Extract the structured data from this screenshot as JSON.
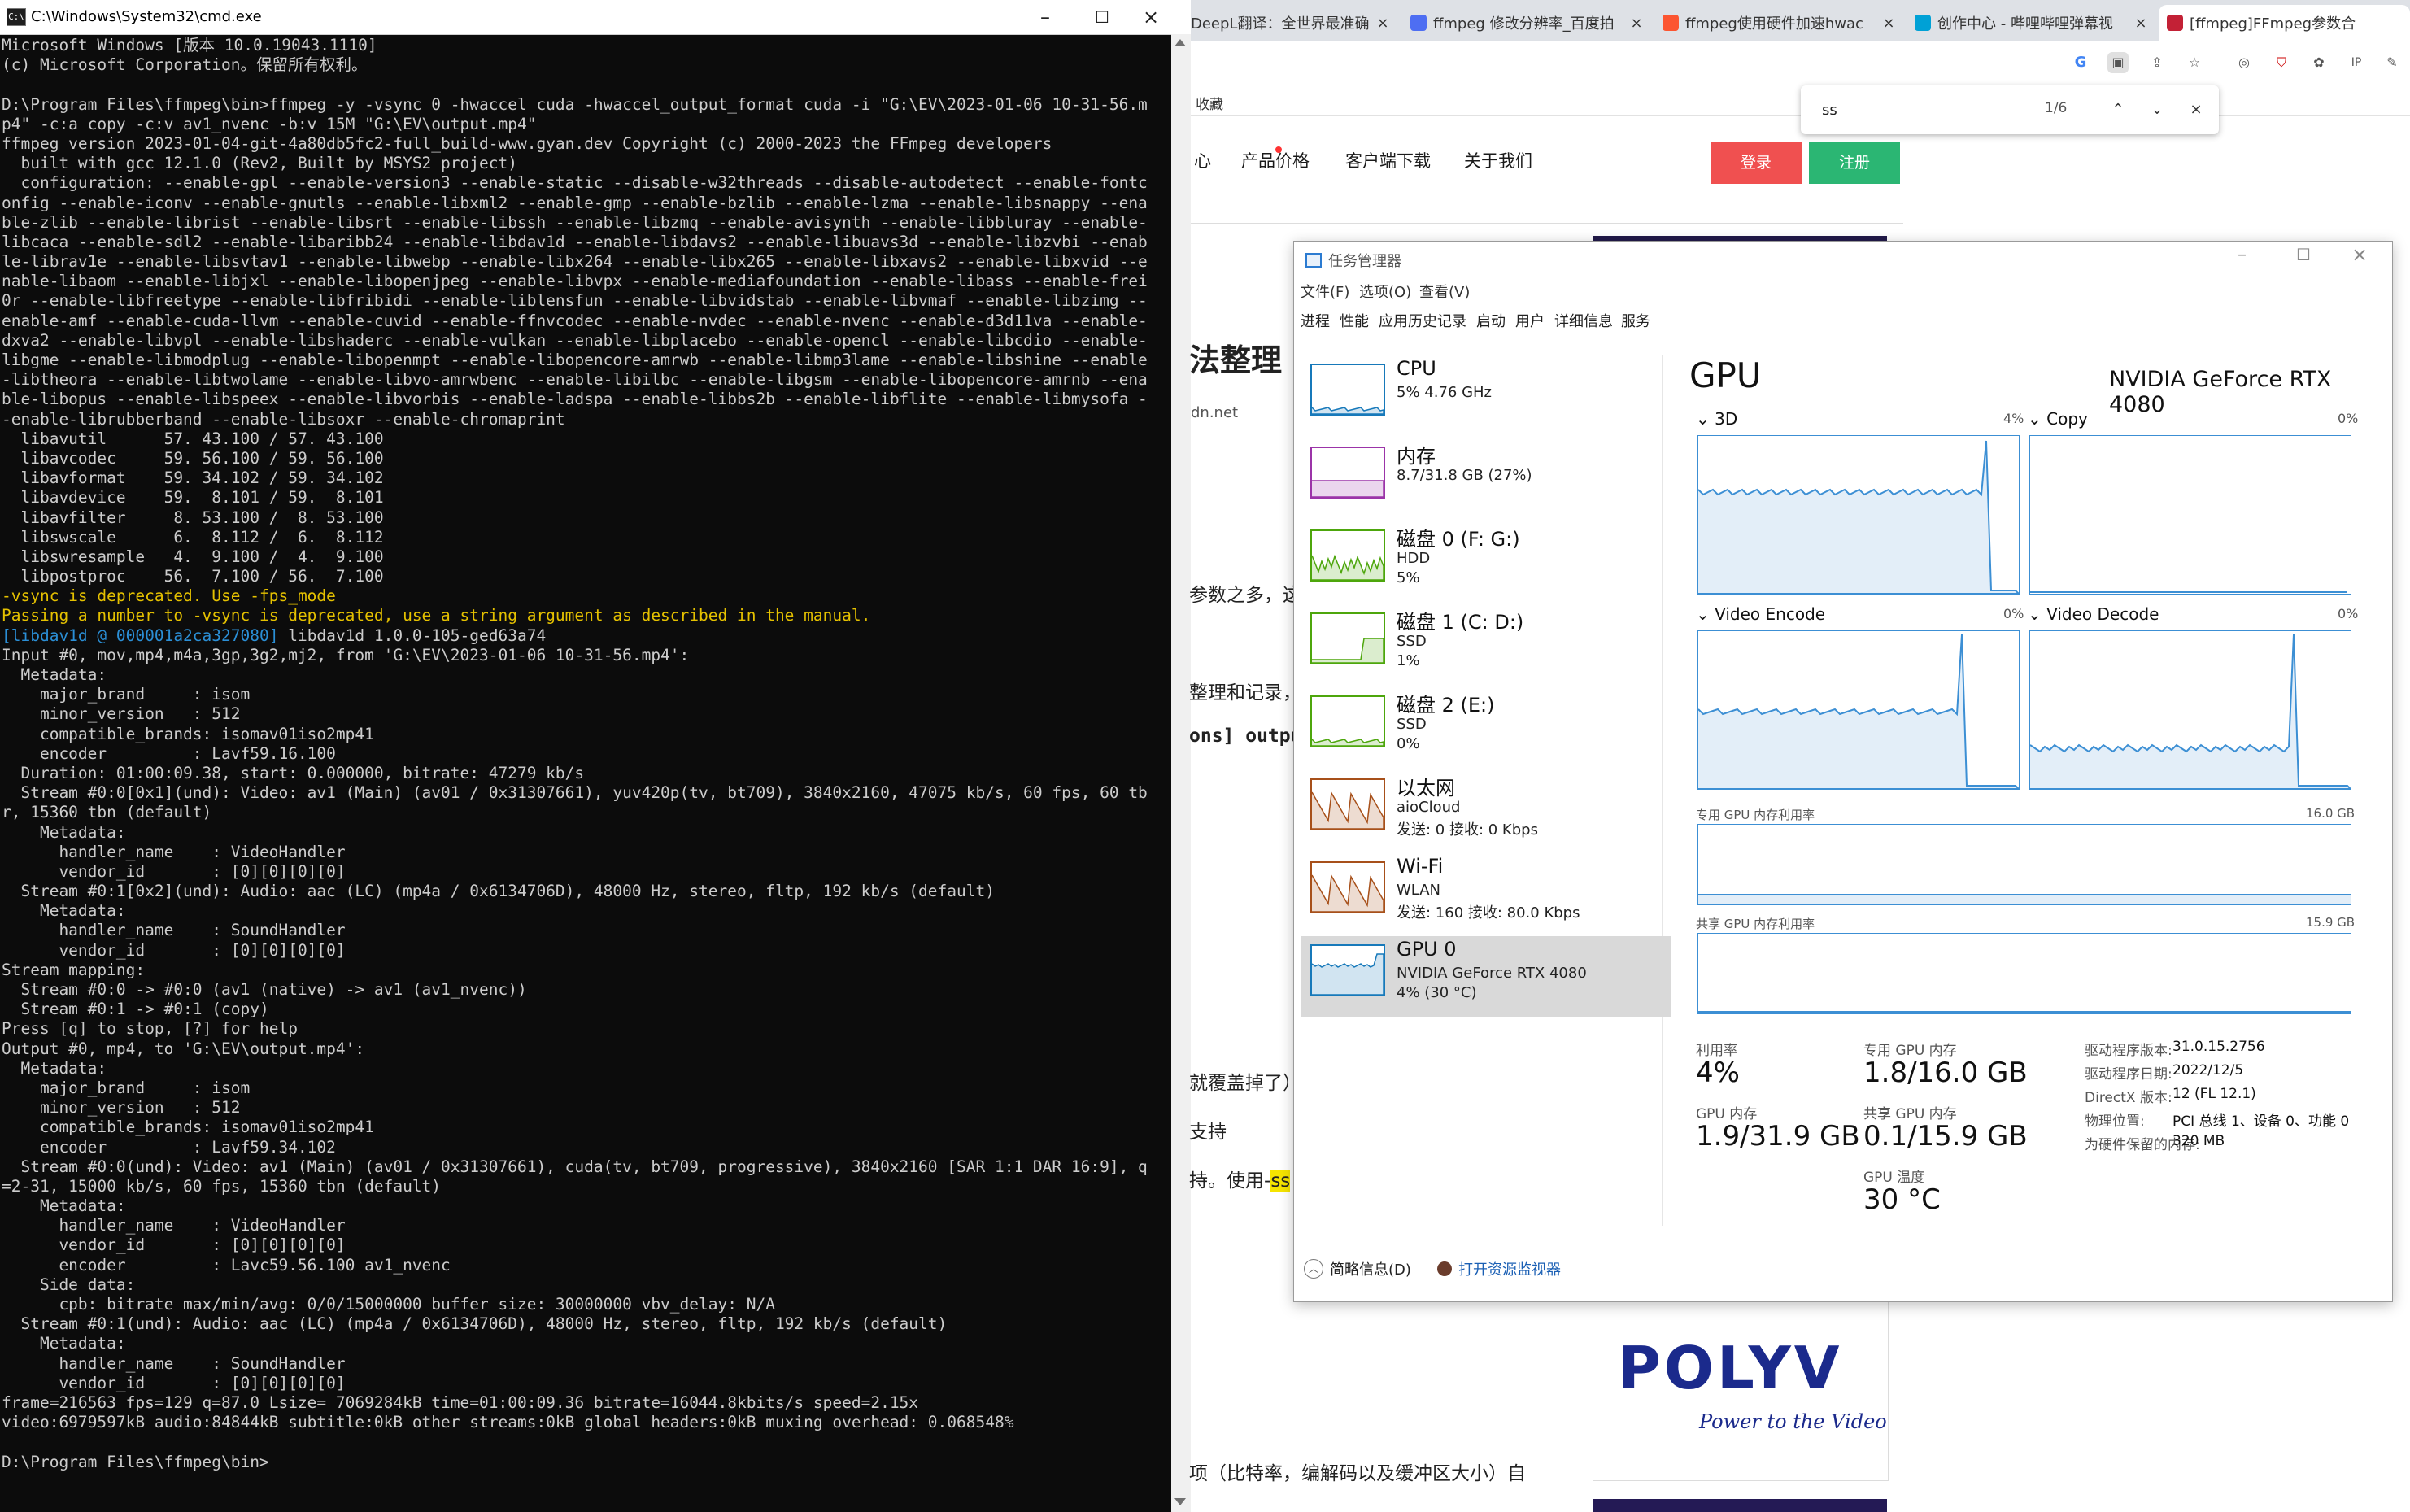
{
  "cmd": {
    "title": "C:\\Windows\\System32\\cmd.exe",
    "icon_text": "C:\\",
    "lines": [
      {
        "t": "Microsoft Windows [版本 10.0.19043.1110]"
      },
      {
        "t": "(c) Microsoft Corporation。保留所有权利。"
      },
      {
        "t": ""
      },
      {
        "t": "D:\\Program Files\\ffmpeg\\bin>ffmpeg -y -vsync 0 -hwaccel cuda -hwaccel_output_format cuda -i \"G:\\EV\\2023-01-06 10-31-56.m"
      },
      {
        "t": "p4\" -c:a copy -c:v av1_nvenc -b:v 15M \"G:\\EV\\output.mp4\""
      },
      {
        "t": "ffmpeg version 2023-01-04-git-4a80db5fc2-full_build-www.gyan.dev Copyright (c) 2000-2023 the FFmpeg developers"
      },
      {
        "t": "  built with gcc 12.1.0 (Rev2, Built by MSYS2 project)"
      },
      {
        "t": "  configuration: --enable-gpl --enable-version3 --enable-static --disable-w32threads --disable-autodetect --enable-fontc"
      },
      {
        "t": "onfig --enable-iconv --enable-gnutls --enable-libxml2 --enable-gmp --enable-bzlib --enable-lzma --enable-libsnappy --ena"
      },
      {
        "t": "ble-zlib --enable-librist --enable-libsrt --enable-libssh --enable-libzmq --enable-avisynth --enable-libbluray --enable-"
      },
      {
        "t": "libcaca --enable-sdl2 --enable-libaribb24 --enable-libdav1d --enable-libdavs2 --enable-libuavs3d --enable-libzvbi --enab"
      },
      {
        "t": "le-librav1e --enable-libsvtav1 --enable-libwebp --enable-libx264 --enable-libx265 --enable-libxavs2 --enable-libxvid --e"
      },
      {
        "t": "nable-libaom --enable-libjxl --enable-libopenjpeg --enable-libvpx --enable-mediafoundation --enable-libass --enable-frei"
      },
      {
        "t": "0r --enable-libfreetype --enable-libfribidi --enable-liblensfun --enable-libvidstab --enable-libvmaf --enable-libzimg --"
      },
      {
        "t": "enable-amf --enable-cuda-llvm --enable-cuvid --enable-ffnvcodec --enable-nvdec --enable-nvenc --enable-d3d11va --enable-"
      },
      {
        "t": "dxva2 --enable-libvpl --enable-libshaderc --enable-vulkan --enable-libplacebo --enable-opencl --enable-libcdio --enable-"
      },
      {
        "t": "libgme --enable-libmodplug --enable-libopenmpt --enable-libopencore-amrwb --enable-libmp3lame --enable-libshine --enable"
      },
      {
        "t": "-libtheora --enable-libtwolame --enable-libvo-amrwbenc --enable-libilbc --enable-libgsm --enable-libopencore-amrnb --ena"
      },
      {
        "t": "ble-libopus --enable-libspeex --enable-libvorbis --enable-ladspa --enable-libbs2b --enable-libflite --enable-libmysofa -"
      },
      {
        "t": "-enable-librubberband --enable-libsoxr --enable-chromaprint"
      },
      {
        "t": "  libavutil      57. 43.100 / 57. 43.100"
      },
      {
        "t": "  libavcodec     59. 56.100 / 59. 56.100"
      },
      {
        "t": "  libavformat    59. 34.102 / 59. 34.102"
      },
      {
        "t": "  libavdevice    59.  8.101 / 59.  8.101"
      },
      {
        "t": "  libavfilter     8. 53.100 /  8. 53.100"
      },
      {
        "t": "  libswscale      6.  8.112 /  6.  8.112"
      },
      {
        "t": "  libswresample   4.  9.100 /  4.  9.100"
      },
      {
        "t": "  libpostproc    56.  7.100 / 56.  7.100"
      },
      {
        "t": "-vsync is deprecated. Use -fps_mode",
        "c": "y"
      },
      {
        "t": "Passing a number to -vsync is deprecated, use a string argument as described in the manual.",
        "c": "y"
      },
      {
        "pre": "[libdav1d @ 000001a2ca327080]",
        "t": " libdav1d 1.0.0-105-ged63a74"
      },
      {
        "t": "Input #0, mov,mp4,m4a,3gp,3g2,mj2, from 'G:\\EV\\2023-01-06 10-31-56.mp4':"
      },
      {
        "t": "  Metadata:"
      },
      {
        "t": "    major_brand     : isom"
      },
      {
        "t": "    minor_version   : 512"
      },
      {
        "t": "    compatible_brands: isomav01iso2mp41"
      },
      {
        "t": "    encoder         : Lavf59.16.100"
      },
      {
        "t": "  Duration: 01:00:09.38, start: 0.000000, bitrate: 47279 kb/s"
      },
      {
        "t": "  Stream #0:0[0x1](und): Video: av1 (Main) (av01 / 0x31307661), yuv420p(tv, bt709), 3840x2160, 47075 kb/s, 60 fps, 60 tb"
      },
      {
        "t": "r, 15360 tbn (default)"
      },
      {
        "t": "    Metadata:"
      },
      {
        "t": "      handler_name    : VideoHandler"
      },
      {
        "t": "      vendor_id       : [0][0][0][0]"
      },
      {
        "t": "  Stream #0:1[0x2](und): Audio: aac (LC) (mp4a / 0x6134706D), 48000 Hz, stereo, fltp, 192 kb/s (default)"
      },
      {
        "t": "    Metadata:"
      },
      {
        "t": "      handler_name    : SoundHandler"
      },
      {
        "t": "      vendor_id       : [0][0][0][0]"
      },
      {
        "t": "Stream mapping:"
      },
      {
        "t": "  Stream #0:0 -> #0:0 (av1 (native) -> av1 (av1_nvenc))"
      },
      {
        "t": "  Stream #0:1 -> #0:1 (copy)"
      },
      {
        "t": "Press [q] to stop, [?] for help"
      },
      {
        "t": "Output #0, mp4, to 'G:\\EV\\output.mp4':"
      },
      {
        "t": "  Metadata:"
      },
      {
        "t": "    major_brand     : isom"
      },
      {
        "t": "    minor_version   : 512"
      },
      {
        "t": "    compatible_brands: isomav01iso2mp41"
      },
      {
        "t": "    encoder         : Lavf59.34.102"
      },
      {
        "t": "  Stream #0:0(und): Video: av1 (Main) (av01 / 0x31307661), cuda(tv, bt709, progressive), 3840x2160 [SAR 1:1 DAR 16:9], q"
      },
      {
        "t": "=2-31, 15000 kb/s, 60 fps, 15360 tbn (default)"
      },
      {
        "t": "    Metadata:"
      },
      {
        "t": "      handler_name    : VideoHandler"
      },
      {
        "t": "      vendor_id       : [0][0][0][0]"
      },
      {
        "t": "      encoder         : Lavc59.56.100 av1_nvenc"
      },
      {
        "t": "    Side data:"
      },
      {
        "t": "      cpb: bitrate max/min/avg: 0/0/15000000 buffer size: 30000000 vbv_delay: N/A"
      },
      {
        "t": "  Stream #0:1(und): Audio: aac (LC) (mp4a / 0x6134706D), 48000 Hz, stereo, fltp, 192 kb/s (default)"
      },
      {
        "t": "    Metadata:"
      },
      {
        "t": "      handler_name    : SoundHandler"
      },
      {
        "t": "      vendor_id       : [0][0][0][0]"
      },
      {
        "t": "frame=216563 fps=129 q=87.0 Lsize= 7069284kB time=01:00:09.36 bitrate=16044.8kbits/s speed=2.15x"
      },
      {
        "t": "video:6979597kB audio:84844kB subtitle:0kB other streams:0kB global headers:0kB muxing overhead: 0.068548%"
      },
      {
        "t": ""
      },
      {
        "t": "D:\\Program Files\\ffmpeg\\bin>"
      }
    ]
  },
  "browser": {
    "tabs": [
      {
        "label": "DeepL翻译：全世界最准确",
        "color": "#0f2b46",
        "active": false
      },
      {
        "label": "ffmpeg 修改分辨率_百度拍",
        "color": "#4e6ef2",
        "active": false
      },
      {
        "label": "ffmpeg使用硬件加速hwac",
        "color": "#fc5531",
        "active": false
      },
      {
        "label": "创作中心 - 哔哩哔哩弹幕视",
        "color": "#00a1d6",
        "active": false
      },
      {
        "label": "[ffmpeg]FFmpeg参数合",
        "color": "#c32136",
        "active": true
      }
    ],
    "bookmark_text": "收藏",
    "nav": [
      "心",
      "产品价格",
      "客户端下载",
      "关于我们"
    ],
    "login": "登录",
    "register": "注册",
    "find": {
      "query": "ss",
      "count": "1/6"
    },
    "fragments": {
      "heading": "法整理",
      "domain": "dn.net",
      "p1": "参数之多，这",
      "p2": "整理和记录，",
      "p3": "ons] outpu",
      "p4": "就覆盖掉了）",
      "p5": "支持",
      "p6": "持。使用-",
      "p6_mark": "ss",
      "p7": "项（比特率，编解码以及缓冲区大小）自"
    },
    "polyv": {
      "logo": "POLYV",
      "slogan": "Power to the Video"
    }
  },
  "taskmgr": {
    "title": "任务管理器",
    "menus": [
      "文件(F)",
      "选项(O)",
      "查看(V)"
    ],
    "tabs": [
      "进程",
      "性能",
      "应用历史记录",
      "启动",
      "用户",
      "详细信息",
      "服务"
    ],
    "resources": [
      {
        "name": "CPU",
        "sub": "5% 4.76 GHz",
        "sub2": "",
        "color": "#1779ba"
      },
      {
        "name": "内存",
        "sub": "8.7/31.8 GB (27%)",
        "sub2": "",
        "color": "#9b34a8"
      },
      {
        "name": "磁盘 0 (F: G:)",
        "sub": "HDD",
        "sub2": "5%",
        "color": "#4da60c"
      },
      {
        "name": "磁盘 1 (C: D:)",
        "sub": "SSD",
        "sub2": "1%",
        "color": "#4da60c"
      },
      {
        "name": "磁盘 2 (E:)",
        "sub": "SSD",
        "sub2": "0%",
        "color": "#4da60c"
      },
      {
        "name": "以太网",
        "sub": "aioCloud",
        "sub2": "发送: 0 接收: 0 Kbps",
        "color": "#a7501a"
      },
      {
        "name": "Wi-Fi",
        "sub": "WLAN",
        "sub2": "发送: 160 接收: 80.0 Kbps",
        "color": "#a7501a"
      },
      {
        "name": "GPU 0",
        "sub": "NVIDIA GeForce RTX 4080",
        "sub2": "4% (30 °C)",
        "color": "#1779ba"
      }
    ],
    "gpu": {
      "title": "GPU",
      "model": "NVIDIA GeForce RTX 4080",
      "engines": [
        {
          "label": "3D",
          "pct": "4%"
        },
        {
          "label": "Copy",
          "pct": "0%"
        },
        {
          "label": "Video Encode",
          "pct": "0%"
        },
        {
          "label": "Video Decode",
          "pct": "0%"
        }
      ],
      "dedicated_label": "专用 GPU 内存利用率",
      "dedicated_max": "16.0 GB",
      "shared_label": "共享 GPU 内存利用率",
      "shared_max": "15.9 GB",
      "stats": [
        {
          "label": "利用率",
          "value": "4%"
        },
        {
          "label": "专用 GPU 内存",
          "value": "1.8/16.0 GB"
        },
        {
          "label": "GPU 内存",
          "value": "1.9/31.9 GB"
        },
        {
          "label": "共享 GPU 内存",
          "value": "0.1/15.9 GB"
        },
        {
          "label": "GPU 温度",
          "value": "30 °C"
        }
      ],
      "info": [
        {
          "label": "驱动程序版本:",
          "value": "31.0.15.2756"
        },
        {
          "label": "驱动程序日期:",
          "value": "2022/12/5"
        },
        {
          "label": "DirectX 版本:",
          "value": "12 (FL 12.1)"
        },
        {
          "label": "物理位置:",
          "value": "PCI 总线 1、设备 0、功能 0"
        },
        {
          "label": "为硬件保留的内存:",
          "value": "320 MB"
        }
      ]
    },
    "footer": {
      "fewer": "简略信息(D)",
      "monitor": "打开资源监视器"
    }
  }
}
